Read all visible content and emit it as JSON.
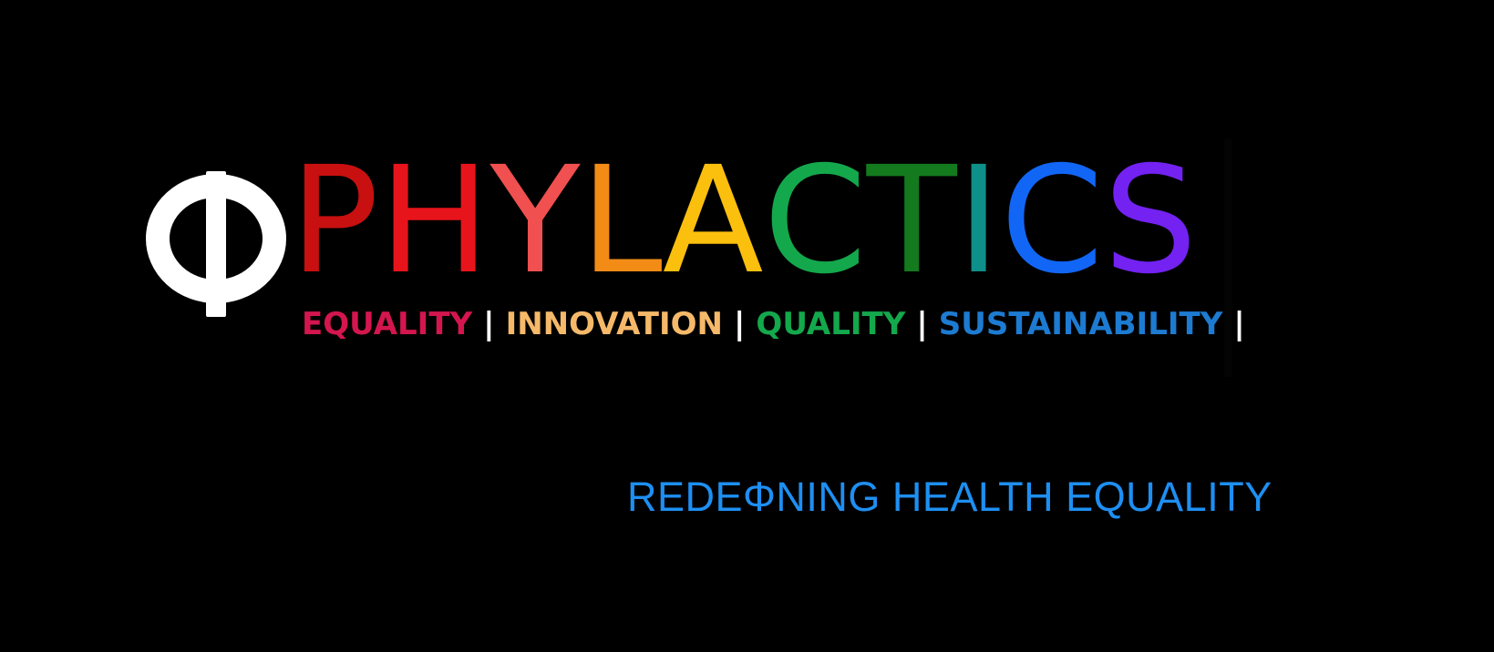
{
  "logo": {
    "symbol": "Φ",
    "symbol_color": "#ffffff",
    "letters": [
      {
        "char": "P",
        "color": "#c81010"
      },
      {
        "char": "H",
        "color": "#e8141c"
      },
      {
        "char": "Y",
        "color": "#f0504f"
      },
      {
        "char": "L",
        "color": "#f28c16"
      },
      {
        "char": "A",
        "color": "#fbbf0e"
      },
      {
        "char": "C",
        "color": "#14a84c"
      },
      {
        "char": "T",
        "color": "#137a1e"
      },
      {
        "char": "I",
        "color": "#0f8f8a"
      },
      {
        "char": "C",
        "color": "#1166f5"
      },
      {
        "char": "S",
        "color": "#7322f2"
      }
    ]
  },
  "tagline": {
    "items": [
      {
        "text": "EQUALITY",
        "color": "#d4164e"
      },
      {
        "text": "INNOVATION",
        "color": "#f5b969"
      },
      {
        "text": "QUALITY",
        "color": "#14a84c"
      },
      {
        "text": "SUSTAINABILITY",
        "color": "#1d7bd1"
      }
    ],
    "separator": "|",
    "separator_color": "#ffffff"
  },
  "subline": {
    "text": "REDEΦNING HEALTH EQUALITY",
    "color": "#1e8ff2"
  },
  "colors": {
    "background": "#000000"
  }
}
